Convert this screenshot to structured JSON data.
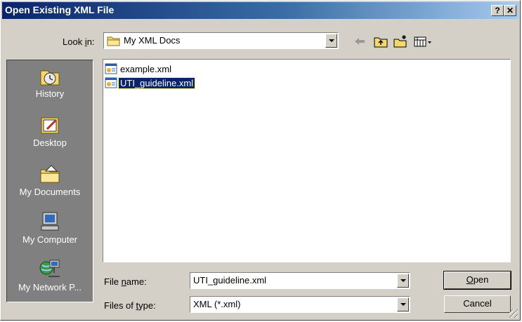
{
  "window": {
    "title": "Open Existing XML File",
    "help_glyph": "?",
    "close_glyph": "✕"
  },
  "toolbar": {
    "look_in_prefix": "Look ",
    "look_in_mnemonic": "i",
    "look_in_suffix": "n:",
    "look_in_value": "My XML Docs",
    "icons": [
      "back-arrow-icon",
      "up-folder-icon",
      "new-folder-icon",
      "view-menu-icon"
    ]
  },
  "places": [
    {
      "label": "History",
      "icon": "history-icon"
    },
    {
      "label": "Desktop",
      "icon": "desktop-icon"
    },
    {
      "label": "My Documents",
      "icon": "my-documents-icon"
    },
    {
      "label": "My Computer",
      "icon": "my-computer-icon"
    },
    {
      "label": "My Network P...",
      "icon": "network-places-icon"
    }
  ],
  "files": [
    {
      "name": "example.xml",
      "selected": false
    },
    {
      "name": "UTI_guideline.xml",
      "selected": true
    }
  ],
  "form": {
    "file_name_prefix": "File ",
    "file_name_mnemonic": "n",
    "file_name_suffix": "ame:",
    "file_name_value": "UTI_guideline.xml",
    "file_type_prefix": "Files of ",
    "file_type_mnemonic": "t",
    "file_type_suffix": "ype:",
    "file_type_value": "XML (*.xml)"
  },
  "buttons": {
    "open_mnemonic": "O",
    "open_rest": "pen",
    "cancel": "Cancel"
  },
  "colors": {
    "titlebar_start": "#0a246a",
    "titlebar_end": "#a6caf0",
    "dialog_face": "#d4d0c8",
    "places_bar": "#808080",
    "selection": "#0a246a"
  }
}
